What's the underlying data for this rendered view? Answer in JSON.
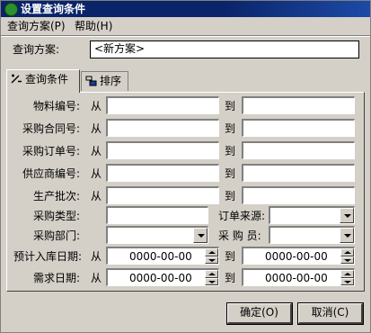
{
  "window": {
    "title": "设置查询条件"
  },
  "menu": [
    {
      "label": "查询方案(P)"
    },
    {
      "label": "帮助(H)"
    }
  ],
  "scheme": {
    "label": "查询方案:",
    "value": "<新方案>"
  },
  "tabs": [
    {
      "label": "查询条件",
      "icon": "filter-icon",
      "active": true
    },
    {
      "label": "排序",
      "icon": "sort-icon",
      "active": false
    }
  ],
  "form": {
    "from": "从",
    "to": "到",
    "material_code": "物料编号:",
    "contract_no": "采购合同号:",
    "order_no": "采购订单号:",
    "supplier_code": "供应商编号:",
    "batch_no": "生产批次:",
    "purchase_type": "采购类型:",
    "order_source": "订单来源:",
    "purchase_dept": "采购部门:",
    "buyer": "采 购 员:",
    "expected_date": "预计入库日期:",
    "required_date": "需求日期:",
    "date_placeholder": "0000-00-00"
  },
  "buttons": {
    "ok": "确定(O)",
    "cancel": "取消(C)"
  }
}
